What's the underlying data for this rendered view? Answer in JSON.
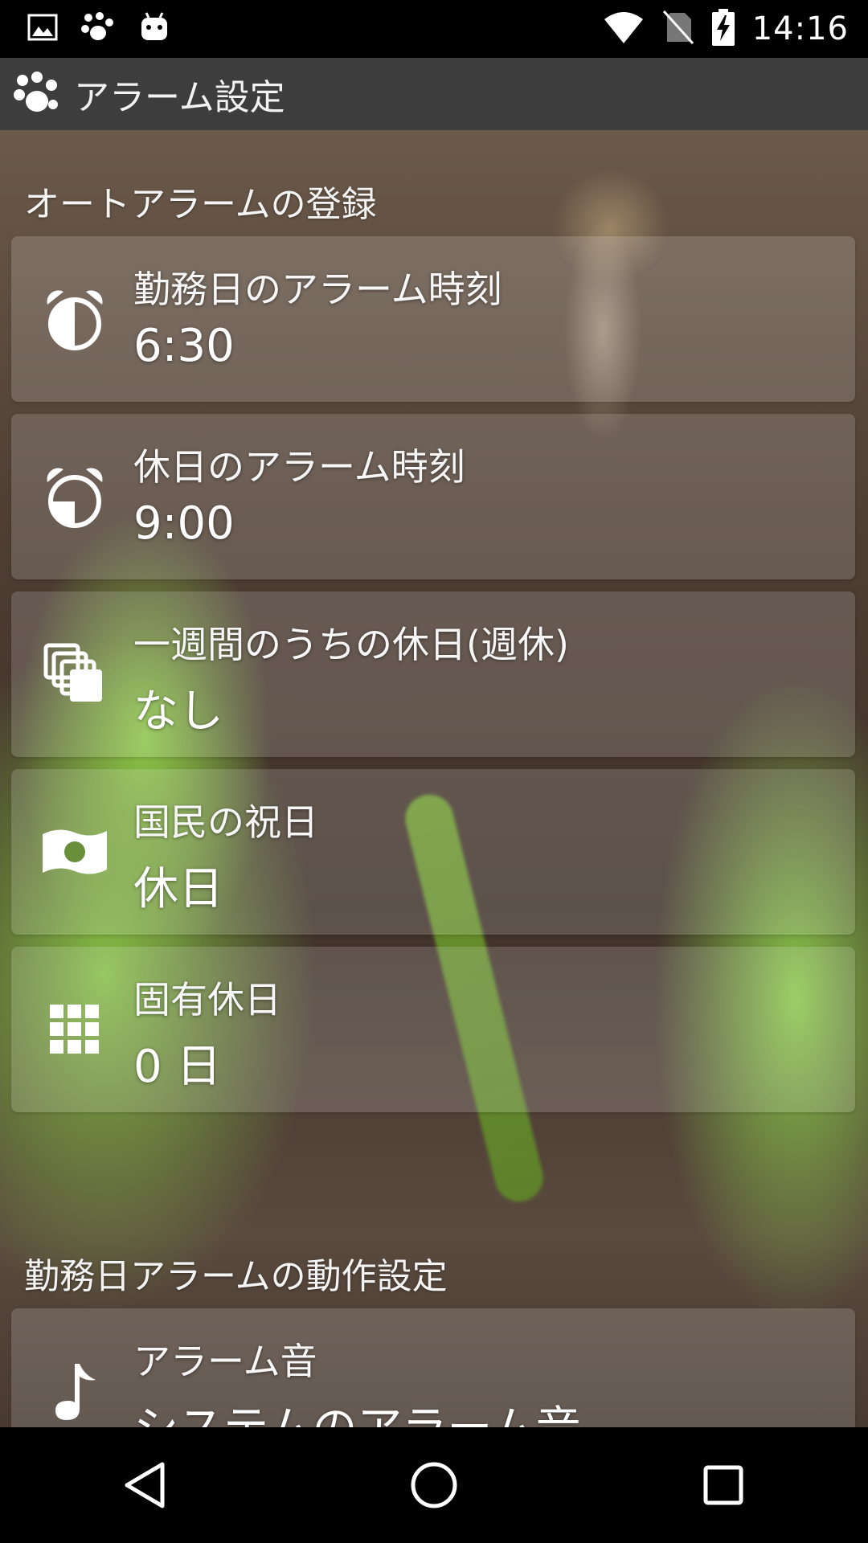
{
  "status_bar": {
    "time": "14:16",
    "left_icons": [
      "image-icon",
      "paw-icon",
      "android-icon"
    ],
    "right_icons": [
      "wifi-icon",
      "no-sim-icon",
      "battery-charging-icon"
    ]
  },
  "action_bar": {
    "title": "アラーム設定",
    "icon": "paw-icon"
  },
  "sections": [
    {
      "header": "オートアラームの登録",
      "items": [
        {
          "label": "勤務日のアラーム時刻",
          "value": "6:30",
          "icon": "alarm-clock-icon"
        },
        {
          "label": "休日のアラーム時刻",
          "value": "9:00",
          "icon": "alarm-clock-icon"
        },
        {
          "label": "一週間のうちの休日(週休)",
          "value": "なし",
          "icon": "stacked-pages-icon"
        },
        {
          "label": "国民の祝日",
          "value": "休日",
          "icon": "flag-icon"
        },
        {
          "label": "固有休日",
          "value": "0 日",
          "icon": "grid-icon"
        }
      ]
    },
    {
      "header": "勤務日アラームの動作設定",
      "items": [
        {
          "label": "アラーム音",
          "value": "システムのアラーム音",
          "icon": "music-note-icon"
        }
      ]
    }
  ],
  "colors": {
    "action_bar": "#3d3d3d",
    "status_bar": "#000000",
    "nav_bar": "#000000",
    "leaf_green": "#8cc846"
  },
  "nav_bar": {
    "buttons": [
      "back-icon",
      "home-icon",
      "recents-icon"
    ]
  }
}
